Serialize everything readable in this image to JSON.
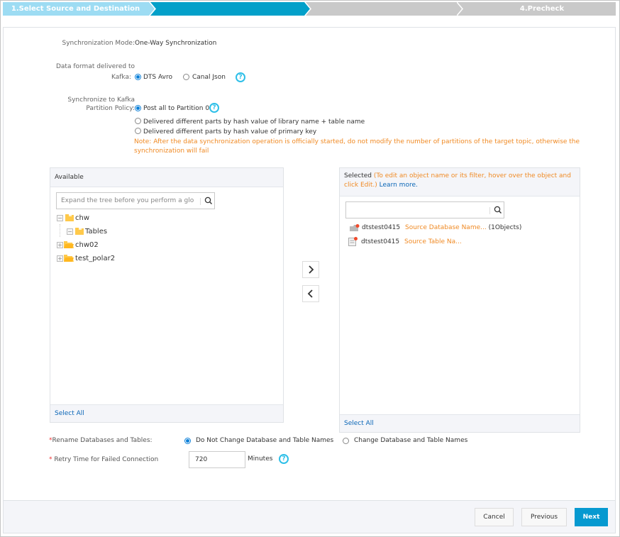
{
  "steps": [
    {
      "label": "1.Select Source and Destination",
      "state": "done",
      "color": "#9ddcf3"
    },
    {
      "label": "",
      "state": "current",
      "color": "#03a0c9"
    },
    {
      "label": "",
      "state": "pending",
      "color": "#c9c9c9"
    },
    {
      "label": "4.Precheck",
      "state": "pending",
      "color": "#c9c9c9"
    }
  ],
  "form": {
    "sync_mode": {
      "label": "Synchronization Mode:",
      "value": "One-Way Synchronization"
    },
    "data_format": {
      "label_line1": "Data format delivered to",
      "label_line2": "Kafka:",
      "options": [
        {
          "label": "DTS Avro",
          "selected": true
        },
        {
          "label": "Canal Json",
          "selected": false
        }
      ],
      "help_icon": "?"
    },
    "partition_policy": {
      "label_line1": "Synchronize to Kafka",
      "label_line2": "Partition Policy:",
      "options": [
        {
          "label": "Post all to Partition 0",
          "selected": true
        },
        {
          "label": "Delivered different parts by hash value of library name + table name",
          "selected": false
        },
        {
          "label": "Delivered different parts by hash value of primary key",
          "selected": false
        }
      ],
      "help_icon": "?",
      "note_line1": "Note: After the data synchronization operation is officially started, do not modify the number of partitions of the target topic, otherwise the",
      "note_line2": "synchronization will fail"
    }
  },
  "available": {
    "title": "Available",
    "search_placeholder": "Expand the tree before you perform a glo",
    "tree": [
      {
        "label": "chw",
        "expanded": true,
        "level": 0
      },
      {
        "label": "Tables",
        "expanded": true,
        "level": 1
      },
      {
        "label": "chw02",
        "expanded": false,
        "level": 0
      },
      {
        "label": "test_polar2",
        "expanded": false,
        "level": 0
      }
    ],
    "select_all": "Select All"
  },
  "transfer": {
    "add": "›",
    "remove": "‹"
  },
  "selected": {
    "title": "Selected",
    "hint": "(To edit an object name or its filter, hover over the object and click Edit.)",
    "learn_more": "Learn more.",
    "search_value": "",
    "items": [
      {
        "name": "dtstest0415",
        "mapping": "Source Database Name...",
        "count": "(1Objects)",
        "type": "database"
      },
      {
        "name": "dtstest0415",
        "mapping": "Source Table Na...",
        "count": "",
        "type": "table"
      }
    ],
    "select_all": "Select All"
  },
  "rename": {
    "required_mark": "*",
    "label": "Rename Databases and Tables:",
    "options": [
      {
        "label": "Do Not Change Database and Table Names",
        "selected": true
      },
      {
        "label": "Change Database and Table Names",
        "selected": false
      }
    ]
  },
  "retry": {
    "required_mark": "*",
    "label": " Retry Time for Failed Connection",
    "value": "720",
    "unit": "Minutes",
    "help_icon": "?"
  },
  "footer": {
    "cancel": "Cancel",
    "previous": "Previous",
    "next": "Next"
  }
}
